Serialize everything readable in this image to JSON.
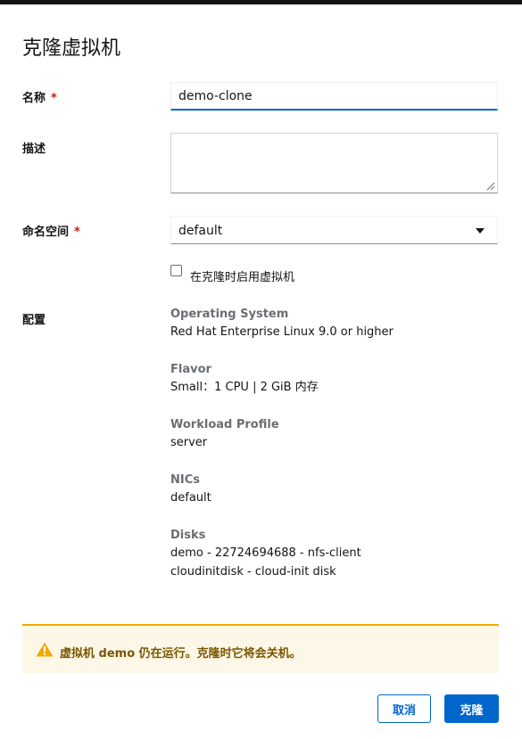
{
  "modal": {
    "title": "克隆虚拟机"
  },
  "form": {
    "name": {
      "label": "名称",
      "required_mark": "*",
      "value": "demo-clone"
    },
    "description": {
      "label": "描述",
      "value": ""
    },
    "namespace": {
      "label": "命名空间",
      "required_mark": "*",
      "selected": "default"
    },
    "start_on_clone": {
      "label": "在克隆时启用虚拟机",
      "checked": false
    },
    "config": {
      "label": "配置",
      "items": [
        {
          "term": "Operating System",
          "values": [
            "Red Hat Enterprise Linux 9.0 or higher"
          ]
        },
        {
          "term": "Flavor",
          "values": [
            "Small：1 CPU | 2 GiB 内存"
          ]
        },
        {
          "term": "Workload Profile",
          "values": [
            "server"
          ]
        },
        {
          "term": "NICs",
          "values": [
            "default"
          ]
        },
        {
          "term": "Disks",
          "values": [
            "demo - 22724694688 - nfs-client",
            "cloudinitdisk - cloud-init disk"
          ]
        }
      ]
    }
  },
  "alert": {
    "variant": "warning",
    "icon": "warning-triangle-icon",
    "title": "虚拟机 demo 仍在运行。克隆时它将会关机。"
  },
  "footer": {
    "cancel_label": "取消",
    "clone_label": "克隆"
  },
  "colors": {
    "primary": "#0066cc",
    "required": "#c9190b",
    "warning_border": "#f0ab00",
    "warning_bg": "#fdf7e7",
    "warning_text": "#795600"
  }
}
